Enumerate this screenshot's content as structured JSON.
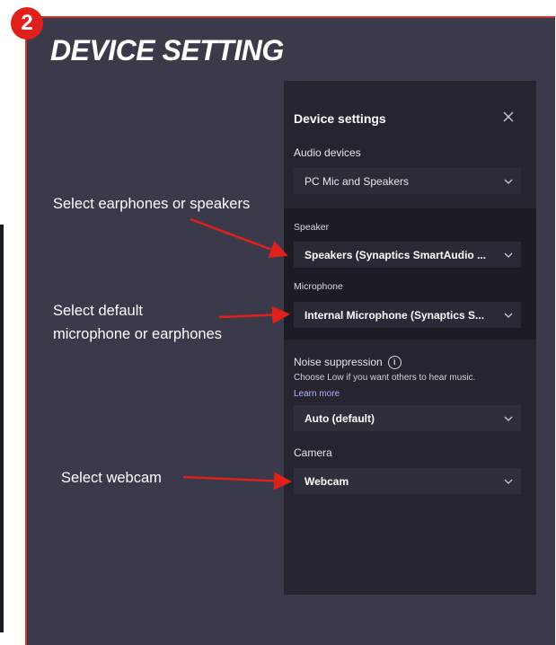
{
  "step_number": "2",
  "slide_title": "DEVICE SETTING",
  "dialog": {
    "title": "Device settings",
    "audio_devices_label": "Audio devices",
    "audio_devices_value": "PC Mic and Speakers",
    "speaker_label": "Speaker",
    "speaker_value": "Speakers (Synaptics SmartAudio ...",
    "microphone_label": "Microphone",
    "microphone_value": "Internal Microphone (Synaptics S...",
    "noise_label": "Noise suppression",
    "noise_hint": "Choose Low if you want others to hear music.",
    "learn_more": "Learn more",
    "noise_value": "Auto (default)",
    "camera_label": "Camera",
    "camera_value": "Webcam"
  },
  "annotations": {
    "speaker": "Select earphones or speakers",
    "microphone_line1": "Select default",
    "microphone_line2": "microphone or earphones",
    "webcam": "Select webcam"
  },
  "colors": {
    "slide_bg": "#3b3a4b",
    "panel_bg": "#26252f",
    "badge": "#e0201b",
    "arrow": "#e0201b"
  }
}
